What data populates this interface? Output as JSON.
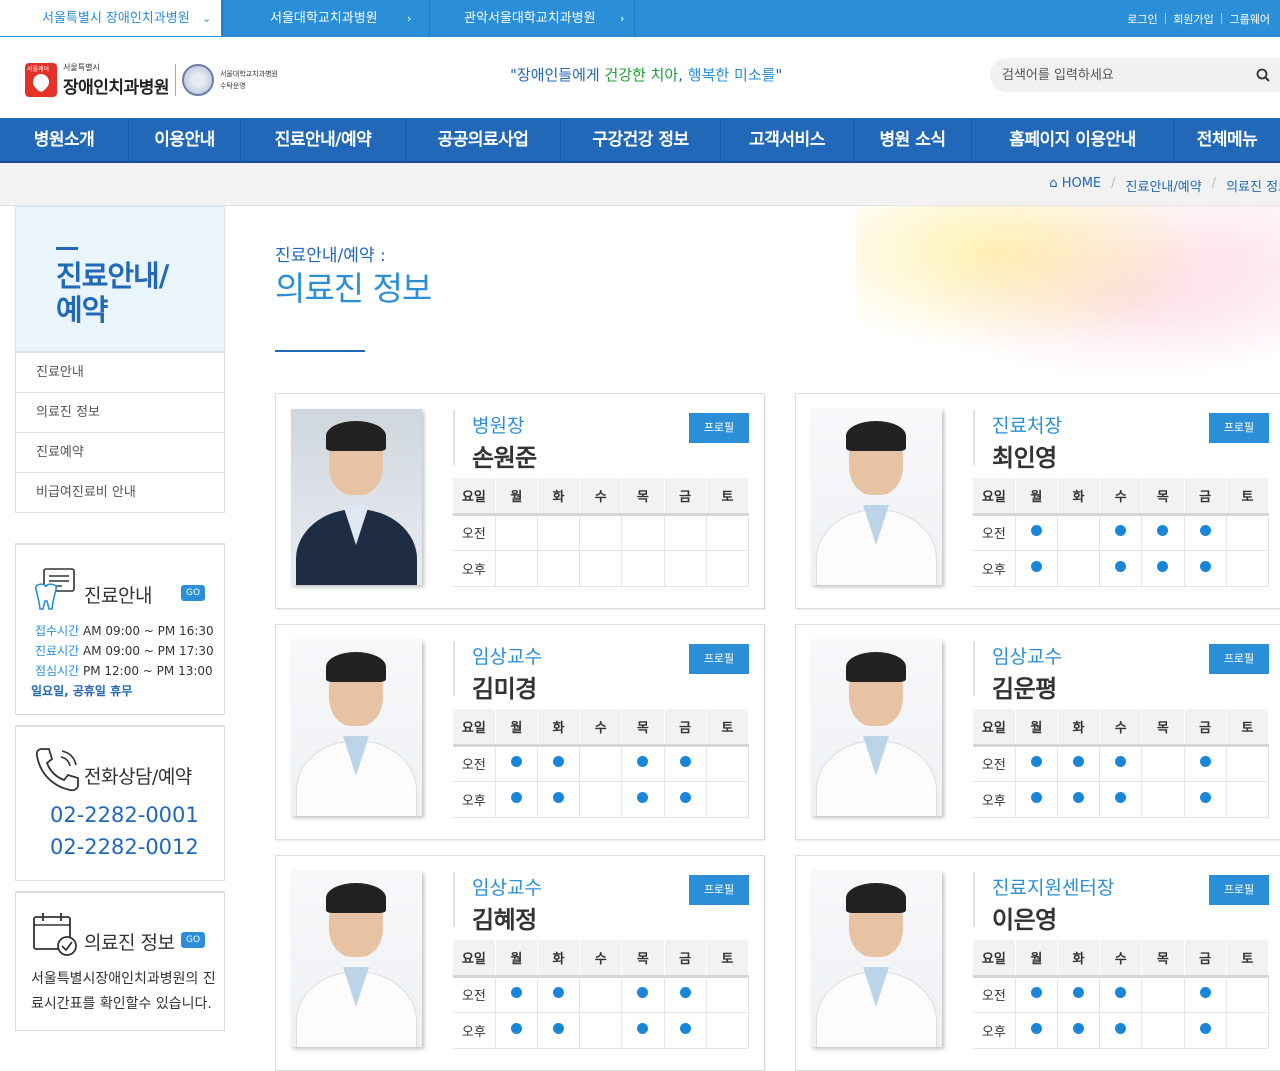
{
  "topbar": {
    "sites": [
      "서울특별시 장애인치과병원",
      "서울대학교치과병원",
      "관악서울대학교치과병원"
    ],
    "util": [
      "로그인",
      "회원가입",
      "그룹웨어"
    ]
  },
  "header": {
    "logo_mark": "서울케어",
    "logo_small": "서울특별시",
    "logo_name": "장애인치과병원",
    "seal_text_1": "서울대학교치과병원",
    "seal_text_2": "수탁운영",
    "slogan_1": "\"장애인들에게 ",
    "slogan_2": "건강한 치아",
    "slogan_3": ", ",
    "slogan_4": "행복한 미소를",
    "slogan_5": "\"",
    "search_placeholder": "검색어를 입력하세요"
  },
  "gnb": [
    "병원소개",
    "이용안내",
    "진료안내/예약",
    "공공의료사업",
    "구강건강 정보",
    "고객서비스",
    "병원 소식",
    "홈페이지 이용안내",
    "전체메뉴"
  ],
  "breadcrumb": [
    "HOME",
    "진료안내/예약",
    "의료진 정보"
  ],
  "side": {
    "title_1": "진료안내/",
    "title_2": "예약",
    "menu": [
      "진료안내",
      "의료진 정보",
      "진료예약",
      "비급여진료비 안내"
    ]
  },
  "box_clinic": {
    "title": "진료안내",
    "go": "GO",
    "rows": [
      {
        "k": "접수시간",
        "v": "AM 09:00 ~ PM 16:30"
      },
      {
        "k": "진료시간",
        "v": "AM 09:00 ~ PM 17:30"
      },
      {
        "k": "점심시간",
        "v": "PM 12:00 ~ PM 13:00"
      }
    ],
    "holiday": "일요일, 공휴일 휴무"
  },
  "box_phone": {
    "title": "전화상담/예약",
    "phone1": "02-2282-0001",
    "phone2": "02-2282-0012"
  },
  "box_doctor": {
    "title": "의료진 정보",
    "go": "GO",
    "desc": "서울특별시장애인치과병원의 진료시간표를 확인할수 있습니다."
  },
  "page": {
    "sub": "진료안내/예약 :",
    "title": "의료진 정보"
  },
  "schedule_headers": [
    "요일",
    "월",
    "화",
    "수",
    "목",
    "금",
    "토"
  ],
  "schedule_rows": [
    "오전",
    "오후"
  ],
  "profile_label": "프로필",
  "doctors": [
    {
      "role": "병원장",
      "name": "손원준",
      "am": [
        0,
        0,
        0,
        0,
        0,
        0
      ],
      "pm": [
        0,
        0,
        0,
        0,
        0,
        0
      ]
    },
    {
      "role": "진료처장",
      "name": "최인영",
      "am": [
        1,
        0,
        1,
        1,
        1,
        0
      ],
      "pm": [
        1,
        0,
        1,
        1,
        1,
        0
      ]
    },
    {
      "role": "임상교수",
      "name": "김미경",
      "am": [
        1,
        1,
        0,
        1,
        1,
        0
      ],
      "pm": [
        1,
        1,
        0,
        1,
        1,
        0
      ]
    },
    {
      "role": "임상교수",
      "name": "김운평",
      "am": [
        1,
        1,
        1,
        0,
        1,
        0
      ],
      "pm": [
        1,
        1,
        1,
        0,
        1,
        0
      ]
    },
    {
      "role": "임상교수",
      "name": "김혜정",
      "am": [
        1,
        1,
        0,
        1,
        1,
        0
      ],
      "pm": [
        1,
        1,
        0,
        1,
        1,
        0
      ]
    },
    {
      "role": "진료지원센터장",
      "name": "이은영",
      "am": [
        1,
        1,
        1,
        0,
        1,
        0
      ],
      "pm": [
        1,
        1,
        1,
        0,
        1,
        0
      ]
    }
  ],
  "colors": {
    "primary": "#2268b8",
    "accent": "#2a8fd6",
    "dot": "#1a86d9",
    "slogan_green": "#1f9b3a"
  }
}
